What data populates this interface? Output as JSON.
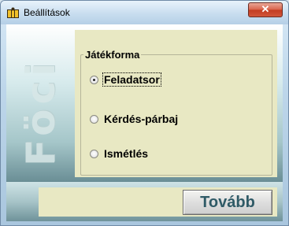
{
  "window": {
    "title": "Beállítások",
    "app_icon": "football-app-icon",
    "close_glyph": "✕"
  },
  "branding": {
    "vertical_text": "Föci"
  },
  "settings": {
    "group_label": "Játékforma",
    "options": [
      {
        "label": "Feladatsor",
        "selected": true,
        "focused": true
      },
      {
        "label": "Kérdés-párbaj",
        "selected": false,
        "focused": false
      },
      {
        "label": "Ismétlés",
        "selected": false,
        "focused": false
      }
    ]
  },
  "actions": {
    "next_label": "Tovább"
  },
  "colors": {
    "panel_bg": "#e8e8c3",
    "button_text": "#2f5a66",
    "close_red": "#c23b20"
  }
}
